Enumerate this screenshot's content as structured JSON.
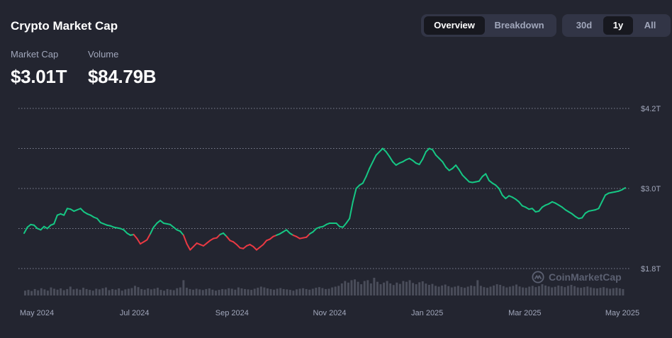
{
  "header": {
    "title": "Crypto Market Cap",
    "view_tabs": [
      {
        "label": "Overview",
        "active": true
      },
      {
        "label": "Breakdown",
        "active": false
      }
    ],
    "range_tabs": [
      {
        "label": "30d",
        "active": false
      },
      {
        "label": "1y",
        "active": true
      },
      {
        "label": "All",
        "active": false
      }
    ]
  },
  "stats": {
    "market_cap": {
      "label": "Market Cap",
      "value": "$3.01T"
    },
    "volume": {
      "label": "Volume",
      "value": "$84.79B"
    }
  },
  "watermark": "CoinMarketCap",
  "colors": {
    "up": "#16c784",
    "down": "#ea3943",
    "volume": "#4a4d5a",
    "grid": "#7f8393",
    "background": "#232530"
  },
  "chart_data": {
    "type": "line",
    "x_tick_labels": [
      "May 2024",
      "Jul 2024",
      "Sep 2024",
      "Nov 2024",
      "Jan 2025",
      "Mar 2025",
      "May 2025"
    ],
    "y_tick_labels": [
      "$4.2T",
      "$3.0T",
      "$1.8T"
    ],
    "y_ticks": [
      4.2,
      3.0,
      1.8
    ],
    "ylim": [
      1.8,
      4.2
    ],
    "grid": true,
    "baseline": 2.3,
    "series": [
      {
        "values": [
          2.33,
          2.42,
          2.46,
          2.45,
          2.4,
          2.38,
          2.43,
          2.4,
          2.45,
          2.47,
          2.6,
          2.62,
          2.6,
          2.7,
          2.69,
          2.66,
          2.68,
          2.7,
          2.65,
          2.62,
          2.6,
          2.57,
          2.55,
          2.49,
          2.47,
          2.45,
          2.44,
          2.42,
          2.41,
          2.4,
          2.38,
          2.33,
          2.3,
          2.31,
          2.25,
          2.17,
          2.2,
          2.23,
          2.32,
          2.42,
          2.48,
          2.52,
          2.48,
          2.47,
          2.46,
          2.42,
          2.38,
          2.36,
          2.3,
          2.17,
          2.08,
          2.13,
          2.18,
          2.16,
          2.14,
          2.18,
          2.22,
          2.25,
          2.26,
          2.31,
          2.33,
          2.28,
          2.22,
          2.2,
          2.16,
          2.11,
          2.1,
          2.14,
          2.16,
          2.13,
          2.08,
          2.12,
          2.16,
          2.22,
          2.24,
          2.28,
          2.3,
          2.32,
          2.35,
          2.38,
          2.33,
          2.3,
          2.28,
          2.25,
          2.26,
          2.27,
          2.32,
          2.35,
          2.4,
          2.42,
          2.43,
          2.46,
          2.48,
          2.48,
          2.48,
          2.43,
          2.42,
          2.48,
          2.55,
          2.8,
          3.0,
          3.05,
          3.08,
          3.18,
          3.3,
          3.4,
          3.5,
          3.55,
          3.6,
          3.55,
          3.48,
          3.4,
          3.35,
          3.38,
          3.4,
          3.43,
          3.45,
          3.42,
          3.38,
          3.36,
          3.44,
          3.55,
          3.6,
          3.58,
          3.5,
          3.45,
          3.4,
          3.32,
          3.27,
          3.3,
          3.35,
          3.28,
          3.2,
          3.15,
          3.1,
          3.09,
          3.1,
          3.11,
          3.18,
          3.22,
          3.12,
          3.08,
          3.05,
          3.0,
          2.9,
          2.85,
          2.89,
          2.87,
          2.84,
          2.8,
          2.74,
          2.72,
          2.69,
          2.7,
          2.65,
          2.66,
          2.72,
          2.75,
          2.77,
          2.8,
          2.78,
          2.75,
          2.72,
          2.68,
          2.65,
          2.62,
          2.58,
          2.55,
          2.56,
          2.63,
          2.66,
          2.67,
          2.68,
          2.7,
          2.8,
          2.9,
          2.93,
          2.94,
          2.95,
          2.96,
          2.98,
          3.01
        ]
      }
    ],
    "volume_values": [
      0.3,
      0.35,
      0.28,
      0.4,
      0.32,
      0.45,
      0.38,
      0.3,
      0.5,
      0.42,
      0.36,
      0.44,
      0.33,
      0.4,
      0.55,
      0.38,
      0.42,
      0.36,
      0.48,
      0.4,
      0.35,
      0.3,
      0.42,
      0.38,
      0.45,
      0.5,
      0.33,
      0.4,
      0.36,
      0.44,
      0.3,
      0.38,
      0.42,
      0.46,
      0.6,
      0.52,
      0.4,
      0.36,
      0.44,
      0.38,
      0.42,
      0.48,
      0.35,
      0.3,
      0.4,
      0.36,
      0.33,
      0.45,
      0.5,
      0.95,
      0.48,
      0.4,
      0.36,
      0.42,
      0.38,
      0.34,
      0.4,
      0.44,
      0.36,
      0.3,
      0.35,
      0.4,
      0.38,
      0.45,
      0.42,
      0.36,
      0.5,
      0.44,
      0.4,
      0.38,
      0.35,
      0.42,
      0.48,
      0.55,
      0.5,
      0.44,
      0.4,
      0.36,
      0.42,
      0.46,
      0.4,
      0.38,
      0.35,
      0.3,
      0.38,
      0.42,
      0.45,
      0.4,
      0.36,
      0.42,
      0.48,
      0.52,
      0.46,
      0.4,
      0.42,
      0.5,
      0.55,
      0.6,
      0.75,
      0.9,
      0.8,
      0.95,
      1.0,
      0.85,
      0.7,
      0.9,
      0.95,
      0.75,
      1.1,
      0.85,
      0.7,
      0.8,
      0.9,
      0.75,
      0.65,
      0.8,
      0.72,
      0.9,
      0.85,
      0.95,
      0.78,
      0.7,
      0.82,
      0.88,
      0.74,
      0.66,
      0.72,
      0.6,
      0.55,
      0.62,
      0.68,
      0.58,
      0.5,
      0.55,
      0.6,
      0.52,
      0.48,
      0.55,
      0.62,
      0.58,
      0.95,
      0.6,
      0.52,
      0.48,
      0.55,
      0.62,
      0.7,
      0.66,
      0.58,
      0.5,
      0.55,
      0.6,
      0.68,
      0.56,
      0.5,
      0.48,
      0.55,
      0.6,
      0.52,
      0.58,
      0.7,
      0.62,
      0.56,
      0.5,
      0.54,
      0.62,
      0.58,
      0.52,
      0.6,
      0.66,
      0.58,
      0.5,
      0.48,
      0.52,
      0.56,
      0.5,
      0.46,
      0.44,
      0.48,
      0.52,
      0.46,
      0.42,
      0.45,
      0.48,
      0.44,
      0.4
    ]
  }
}
